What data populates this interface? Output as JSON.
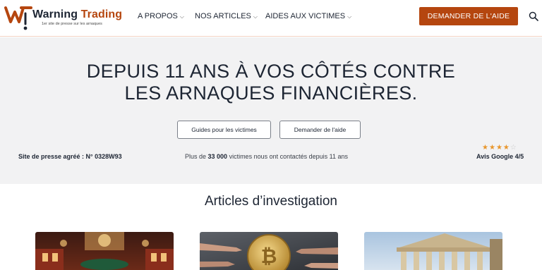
{
  "brand": {
    "name_part1": "Warning",
    "name_part2": "Trading",
    "tagline": "1er site de presse sur les arnaques",
    "accent_color": "#b5460f"
  },
  "nav": {
    "items": [
      {
        "label": "A PROPOS",
        "icon": "chevron-down-icon"
      },
      {
        "label": "NOS ARTICLES",
        "icon": "chevron-down-icon"
      },
      {
        "label": "AIDES AUX VICTIMES",
        "icon": "chevron-down-icon"
      }
    ],
    "cta_label": "DEMANDER DE L'AIDE",
    "search_icon": "search-icon"
  },
  "hero": {
    "title_line1": "DEPUIS 11 ANS À VOS CÔTÉS CONTRE",
    "title_line2": "LES ARNAQUES FINANCIÈRES.",
    "button_guides": "Guides pour les victimes",
    "button_help": "Demander de l'aide",
    "press_label": "Site de presse agréé : N° 0328W93",
    "victims_prefix": "Plus de ",
    "victims_count": "33 000",
    "victims_suffix": " victimes nous ont contactés depuis 11 ans",
    "rating_stars": 4,
    "rating_max": 5,
    "google_label": "Avis Google 4/5"
  },
  "articles": {
    "section_title": "Articles d’investigation",
    "cards": [
      {
        "image": "casino-interior-image"
      },
      {
        "image": "bitcoin-coin-image"
      },
      {
        "image": "classical-building-image"
      }
    ]
  }
}
